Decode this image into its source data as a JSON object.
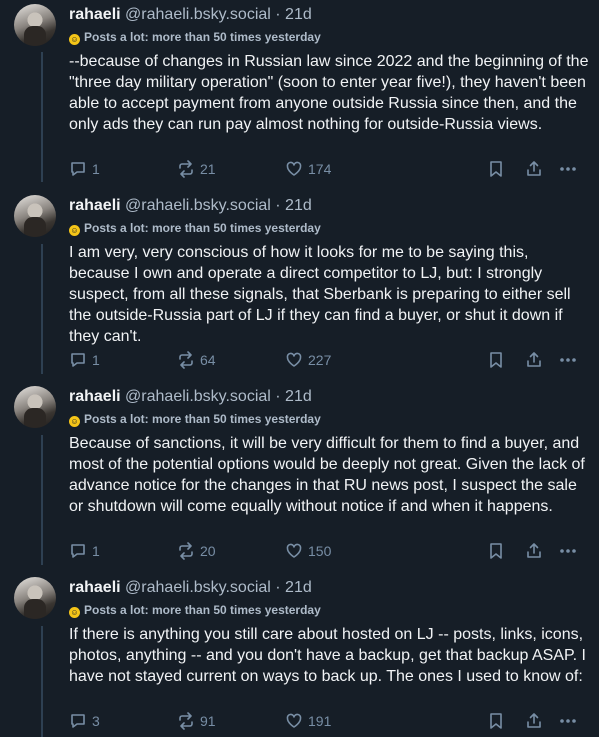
{
  "posts": [
    {
      "author": "rahaeli",
      "handle": "@rahaeli.bsky.social",
      "time": "· 21d",
      "badge": "Posts a lot: more than 50 times yesterday",
      "text": "--because of changes in Russian law since 2022 and the beginning of the \"three day military operation\" (soon to enter year five!), they haven't been able to accept payment from anyone outside Russia since then, and the only ads they can run pay almost nothing for outside-Russia views.",
      "replies": "1",
      "reposts": "21",
      "likes": "174"
    },
    {
      "author": "rahaeli",
      "handle": "@rahaeli.bsky.social",
      "time": "· 21d",
      "badge": "Posts a lot: more than 50 times yesterday",
      "text": "I am very, very conscious of how it looks for me to be saying this, because I own and operate a direct competitor to LJ, but: I strongly suspect, from all these signals, that Sberbank is preparing to either sell the outside-Russia part of LJ if they can find a buyer, or shut it down if they can't.",
      "replies": "1",
      "reposts": "64",
      "likes": "227"
    },
    {
      "author": "rahaeli",
      "handle": "@rahaeli.bsky.social",
      "time": "· 21d",
      "badge": "Posts a lot: more than 50 times yesterday",
      "text": "Because of sanctions, it will be very difficult for them to find a buyer, and most of the potential options would be deeply not great. Given the lack of advance notice for the changes in that RU news post, I suspect the sale or shutdown will come equally without notice if and when it happens.",
      "replies": "1",
      "reposts": "20",
      "likes": "150"
    },
    {
      "author": "rahaeli",
      "handle": "@rahaeli.bsky.social",
      "time": "· 21d",
      "badge": "Posts a lot: more than 50 times yesterday",
      "text": "If there is anything you still care about hosted on LJ -- posts, links, icons, photos, anything -- and you don't have a backup, get that backup ASAP. I have not stayed current on ways to back up. The ones I used to know of:",
      "replies": "3",
      "reposts": "91",
      "likes": "191"
    }
  ],
  "icons": {
    "badge": "smiley-badge-icon",
    "reply": "comment-icon",
    "repost": "repost-icon",
    "like": "heart-icon",
    "bookmark": "bookmark-icon",
    "share": "share-icon",
    "more": "more-icon"
  },
  "colors": {
    "background": "#161e27",
    "text": "#f1f3f5",
    "muted": "#aebbc9",
    "action": "#788ea5",
    "badge": "#f5c518"
  }
}
